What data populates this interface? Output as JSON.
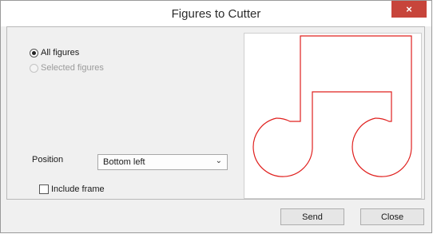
{
  "window": {
    "title": "Figures to Cutter",
    "close_glyph": "×"
  },
  "selection": {
    "all_figures_label": "All figures",
    "all_figures_checked": true,
    "selected_figures_label": "Selected figures",
    "selected_figures_enabled": false
  },
  "position": {
    "label": "Position",
    "value": "Bottom left"
  },
  "include_frame": {
    "label": "Include frame",
    "checked": false
  },
  "buttons": {
    "send": "Send",
    "close": "Close"
  },
  "preview": {
    "figure": "music-note-outline",
    "stroke_color": "#e0201e"
  }
}
